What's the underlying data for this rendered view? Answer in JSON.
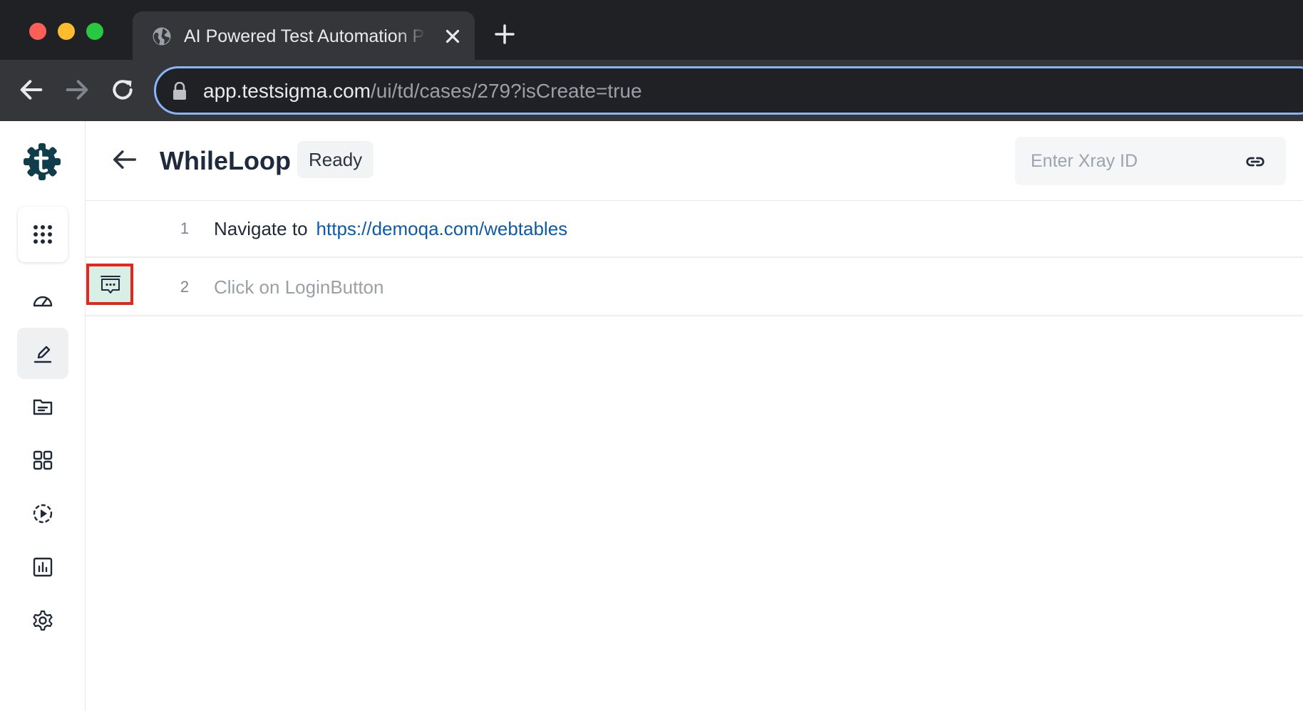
{
  "browser": {
    "tab_title": "AI Powered Test Automation Platform",
    "url_host": "app.testsigma.com",
    "url_path": "/ui/td/cases/279?isCreate=true"
  },
  "header": {
    "title": "WhileLoop",
    "status": "Ready",
    "xray_placeholder": "Enter Xray ID"
  },
  "steps": [
    {
      "number": "1",
      "action": "Navigate to",
      "target": "https://demoqa.com/webtables"
    },
    {
      "number": "2",
      "action": "Click on LoginButton"
    }
  ],
  "colors": {
    "brand": "#0f3d4c",
    "link": "#0d5aa7",
    "highlight_border": "#e8251a",
    "comment_button_bg": "#d8efe6"
  },
  "icons": {
    "sidebar": [
      "apps-grid-icon",
      "dashboard-gauge-icon",
      "edit-pen-icon",
      "folder-icon",
      "grid-icon",
      "play-circle-icon",
      "chart-icon",
      "gear-icon"
    ]
  }
}
